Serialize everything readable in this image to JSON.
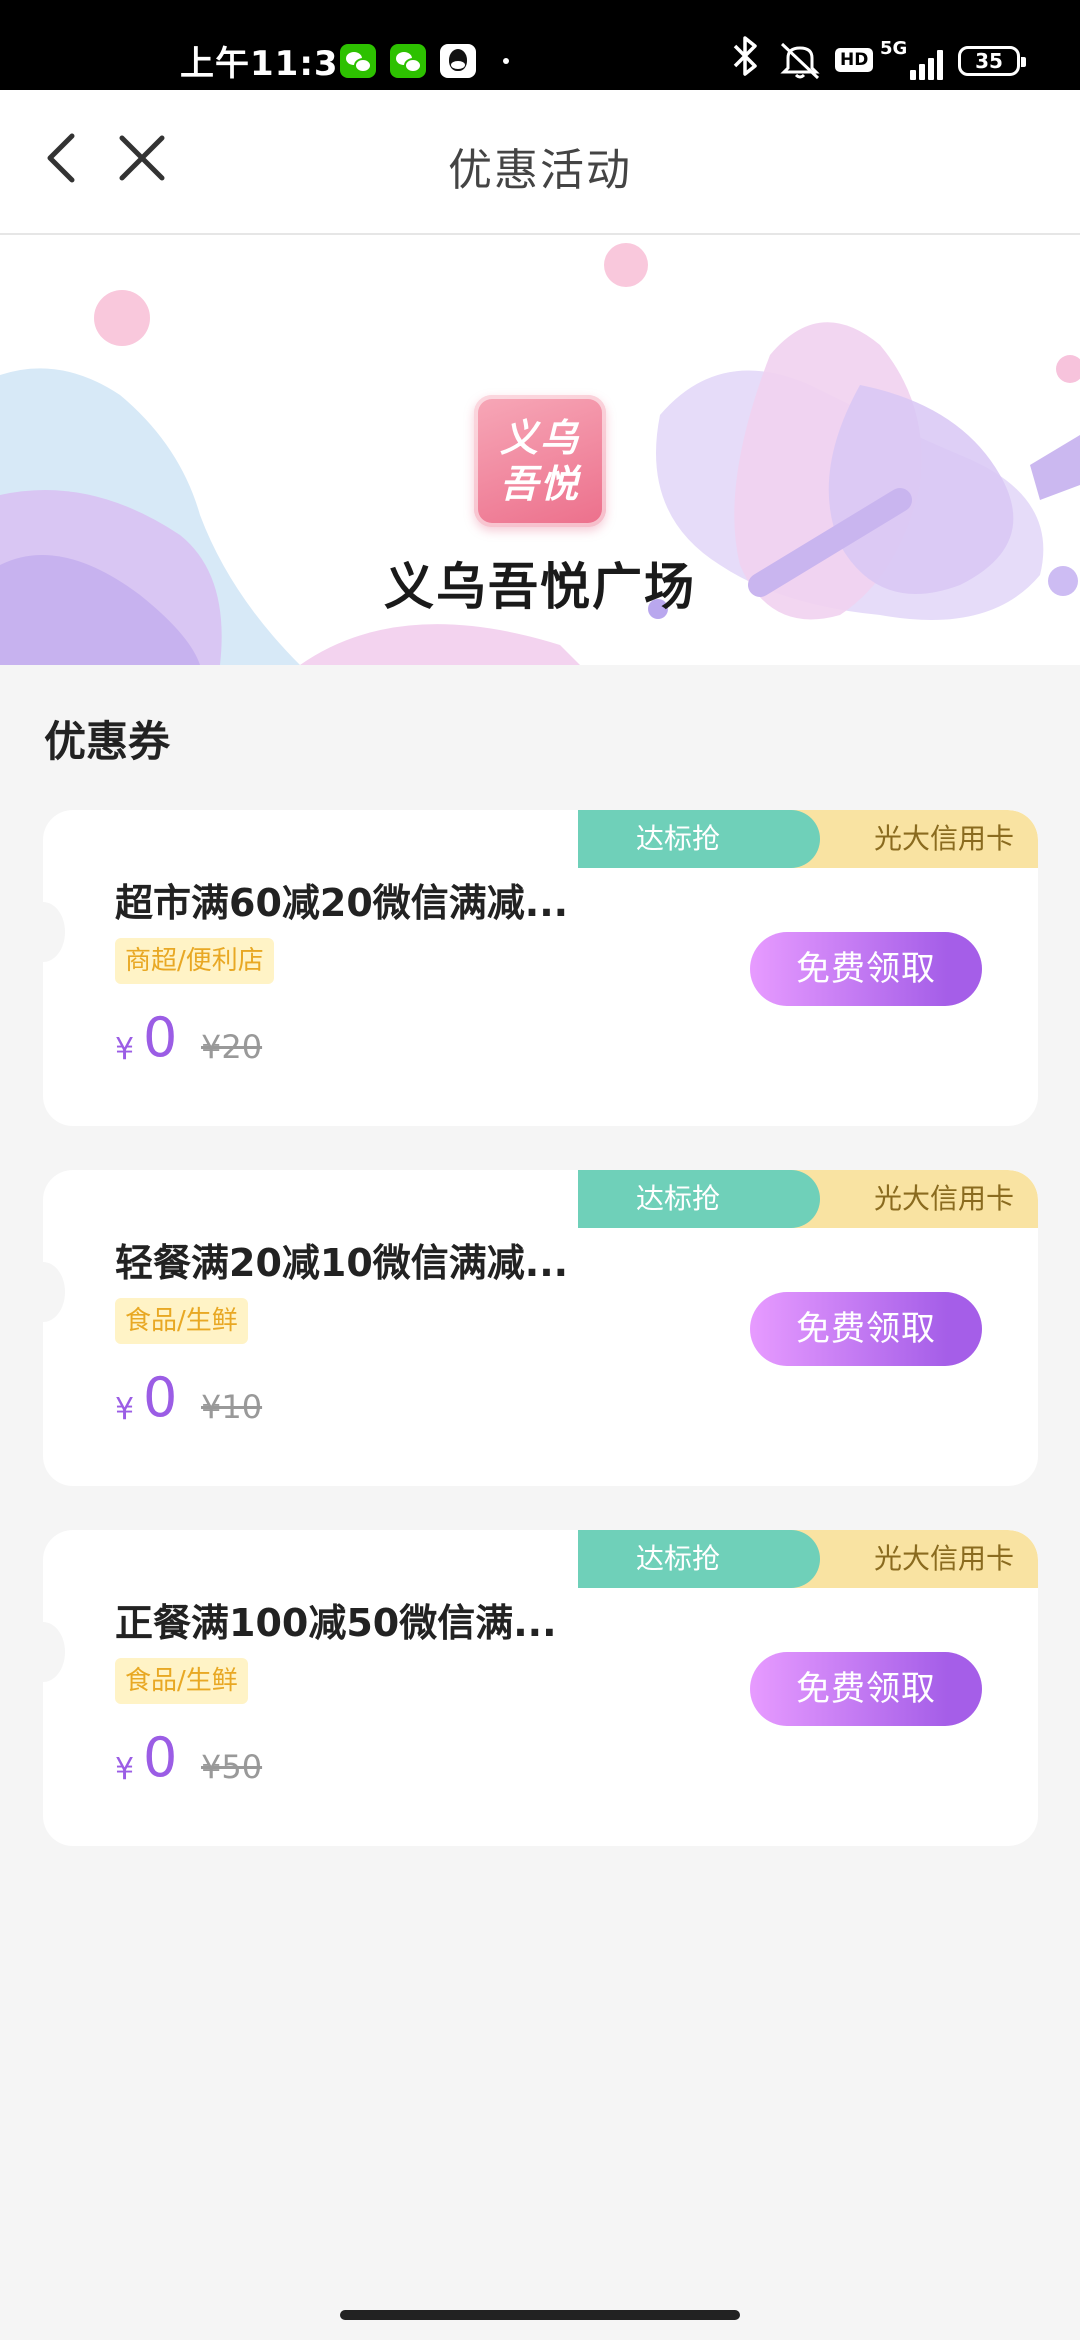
{
  "status_bar": {
    "time": "上午11:34",
    "network": "5G",
    "hd_badge": "HD",
    "battery": "35",
    "icons": [
      "wechat-icon",
      "wechat-icon",
      "qq-icon",
      "bluetooth-icon",
      "mute-icon",
      "signal-icon",
      "battery-icon"
    ]
  },
  "header": {
    "title": "优惠活动",
    "back_icon": "chevron-left-icon",
    "close_icon": "close-icon"
  },
  "banner": {
    "logo_text_line1": "义乌",
    "logo_text_line2": "吾悦",
    "mall_name": "义乌吾悦广场"
  },
  "section": {
    "title": "优惠券"
  },
  "coupons": [
    {
      "tag_green": "达标抢",
      "tag_yellow": "光大信用卡",
      "title": "超市满60减20微信满减...",
      "category": "商超/便利店",
      "currency": "¥",
      "price": "0",
      "original_price": "¥20",
      "button": "免费领取"
    },
    {
      "tag_green": "达标抢",
      "tag_yellow": "光大信用卡",
      "title": "轻餐满20减10微信满减...",
      "category": "食品/生鲜",
      "currency": "¥",
      "price": "0",
      "original_price": "¥10",
      "button": "免费领取"
    },
    {
      "tag_green": "达标抢",
      "tag_yellow": "光大信用卡",
      "title": "正餐满100减50微信满...",
      "category": "食品/生鲜",
      "currency": "¥",
      "price": "0",
      "original_price": "¥50",
      "button": "免费领取"
    }
  ],
  "colors": {
    "accent_purple": "#9b5de5",
    "tag_green": "#6fd0b9",
    "tag_yellow": "#f9e3a2",
    "category_text": "#e8a824",
    "page_background": "#f5f5f5"
  }
}
